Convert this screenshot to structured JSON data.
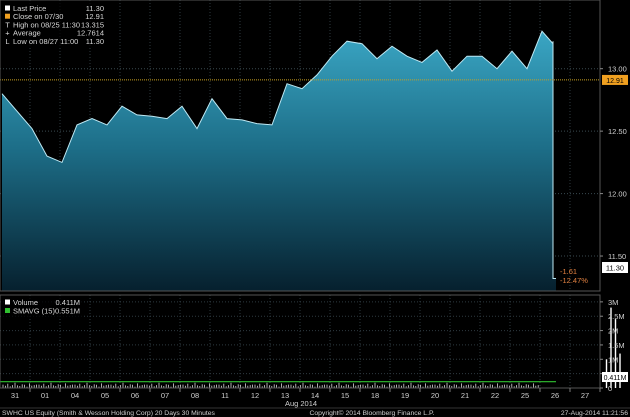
{
  "chart_data": [
    {
      "type": "area",
      "title": "SWHC US Equity (Smith & Wesson Holding Corp) 20 Days 30 Minutes",
      "legend": [
        {
          "label": "Last Price",
          "value": "11.30",
          "color": "#ffffff",
          "glyph": "square"
        },
        {
          "label": "Close on 07/30",
          "value": "12.91",
          "color": "#f0a020",
          "glyph": "square"
        },
        {
          "label": "High on 08/25 11:30",
          "value": "13.315",
          "color": "#d8d8d8",
          "glyph": "T"
        },
        {
          "label": "Average",
          "value": "12.7614",
          "color": "#d8d8d8",
          "glyph": "+"
        },
        {
          "label": "Low on 08/27 11:00",
          "value": "11.30",
          "color": "#d8d8d8",
          "glyph": "L"
        }
      ],
      "y_ticks": [
        11.5,
        12.0,
        12.5,
        13.0
      ],
      "y_tick_labels": [
        "11.50",
        "12.00",
        "12.50",
        "13.00"
      ],
      "ylim": [
        11.22,
        13.55
      ],
      "grid": true,
      "reference_line": {
        "value": 12.91,
        "label": "Close on 07/30",
        "color": "#c8a020"
      },
      "last_price_label": "11.30",
      "change_annotation": {
        "abs": "-1.61",
        "pct": "-12.47%"
      },
      "series": [
        {
          "name": "Last Price",
          "color": "#3aa6c4",
          "x": [
            0,
            0.5,
            1,
            1.5,
            2,
            2.5,
            3,
            3.5,
            4,
            4.5,
            5,
            5.5,
            6,
            6.5,
            7,
            7.5,
            8,
            8.5,
            9,
            9.5,
            10,
            10.5,
            11,
            11.5,
            12,
            12.5,
            13,
            13.5,
            14,
            14.5,
            15,
            15.5,
            16,
            16.5,
            17,
            17.5,
            18,
            18.5,
            19,
            19.5,
            20,
            20.2,
            20.4,
            20.6,
            20.8
          ],
          "values": [
            12.8,
            12.66,
            12.52,
            12.3,
            12.25,
            12.55,
            12.6,
            12.55,
            12.7,
            12.63,
            12.62,
            12.6,
            12.7,
            12.52,
            12.76,
            12.6,
            12.59,
            12.56,
            12.55,
            12.88,
            12.84,
            12.95,
            13.1,
            13.22,
            13.2,
            13.08,
            13.18,
            13.1,
            13.05,
            13.15,
            12.98,
            13.1,
            13.1,
            13.0,
            13.14,
            13.0,
            13.3,
            13.2,
            13.22,
            13.06,
            12.98,
            13.08,
            13.05,
            11.5,
            11.32
          ]
        }
      ]
    },
    {
      "type": "bar",
      "title": "Volume",
      "legend": [
        {
          "label": "Volume",
          "value": "0.411M",
          "color": "#ffffff"
        },
        {
          "label": "SMAVG (15)",
          "value": "0.551M",
          "color": "#30c030"
        }
      ],
      "y_ticks": [
        0,
        0.5,
        1,
        1.5,
        2,
        2.5,
        3
      ],
      "y_tick_labels": [
        "0",
        "",
        "1M",
        "1.5M",
        "2M",
        "2.5M",
        "3M"
      ],
      "ylim": [
        0,
        3.1
      ],
      "last_volume_label": "0.411M",
      "smavg_level": 0.22,
      "spike_x": [
        20.15,
        20.3,
        20.45,
        20.6
      ],
      "spike_values": [
        1.0,
        2.8,
        2.4,
        1.2
      ],
      "x_tick_labels": [
        "31",
        "01",
        "04",
        "05",
        "06",
        "07",
        "08",
        "11",
        "12",
        "13",
        "14",
        "15",
        "18",
        "19",
        "20",
        "21",
        "22",
        "25",
        "26",
        "27"
      ],
      "x_group_label": "Aug 2014"
    }
  ],
  "footer": {
    "left": "SWHC US Equity (Smith & Wesson Holding Corp) 20 Days 30 Minutes",
    "center": "Copyright© 2014 Bloomberg Finance L.P.",
    "right": "27-Aug-2014 11:21:56"
  }
}
